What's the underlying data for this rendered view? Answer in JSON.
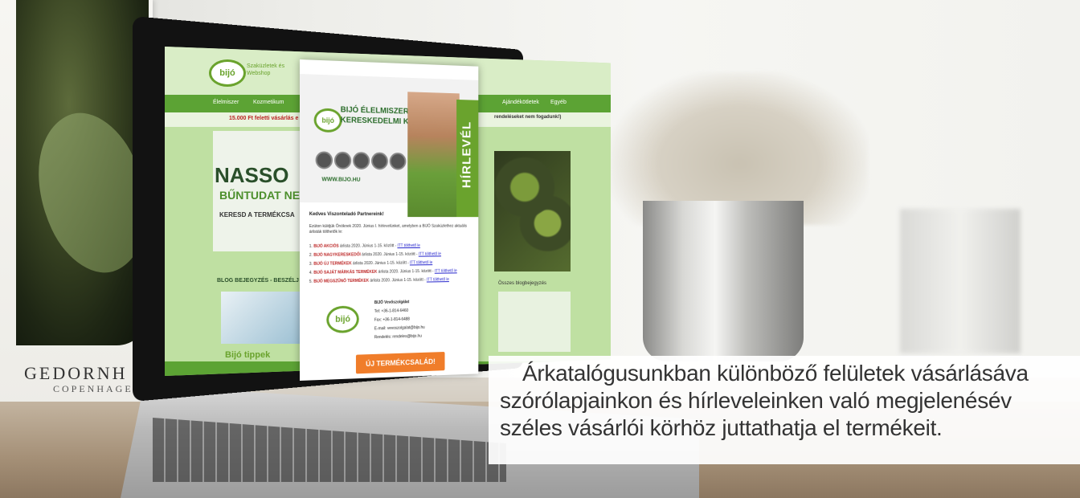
{
  "poster": {
    "brand": "GEDORNH",
    "city": "COPENHAGEN"
  },
  "site": {
    "logo": "bijó",
    "tagline": "Szaküzletek és Webshop",
    "nav_items": [
      "Élelmiszer",
      "Kozmetikum",
      "Ajándékötletek",
      "Egyéb"
    ],
    "promo": "15.000 Ft feletti vásárlás e",
    "hero_title": "NASSO",
    "hero_sub": "BŰNTUDAT NE",
    "hero_sub2": "KERESD A TERMÉKCSA",
    "blog_head": "BLOG BEJEGYZÉS - BESZÉLJ",
    "blog_title": "Bijó tippek",
    "right_notice": "rendeléseket nem fogadunk!)",
    "right_more": "Összes blogbejegyzés"
  },
  "newsletter": {
    "company_line1": "BIJÓ ÉLELMISZER",
    "company_line2": "KERESKEDELMI KFT.",
    "website": "WWW.BIJO.HU",
    "vertical_label": "HÍRLEVÉL",
    "greeting": "Kedves Viszonteladó Partnereink!",
    "intro": "Ezúton küldjük Önöknek 2020. Június I. hírlevelünket, amelyben a BIJÓ Szaküzlethez aktuális árlisták tölthetők le:",
    "items": [
      {
        "num": "1.",
        "name": "BIJÓ AKCIÓS",
        "text": " árlista 2020. Június 1-15. között - ",
        "link": "ITT tölthető le"
      },
      {
        "num": "2.",
        "name": "BIJÓ NAGYKERESKEDŐI",
        "text": " árlista 2020. Június 1-15. között - ",
        "link": "ITT tölthető le"
      },
      {
        "num": "3.",
        "name": "BIJÓ ÚJ TERMÉKEK",
        "text": " árlista 2020. Június 1-15. között - ",
        "link": "ITT tölthető le"
      },
      {
        "num": "4.",
        "name": "BIJÓ SAJÁT MÁRKÁS TERMÉKEK",
        "text": " árlista 2020. Június 1-15. között - ",
        "link": "ITT tölthető le"
      },
      {
        "num": "5.",
        "name": "BIJÓ MEGSZŰNŐ TERMÉKEK",
        "text": " árlista 2020. Június 1-15. között - ",
        "link": "ITT tölthető le"
      }
    ],
    "logo": "bijó",
    "contact_title": "BIJÓ Vevőszolgálat",
    "tel": "Tel: +36-1-814-6460",
    "fax": "Fax: +36-1-814-6488",
    "email": "E-mail: vevoszolgalat@bijo.hu",
    "order": "Rendelés: rendeles@bijo.hu",
    "cta": "ÚJ TERMÉKCSALÁD!"
  },
  "caption": {
    "line1": "Árkatalógusunkban különböző felületek vásárlásáva",
    "line2": "szórólapjainkon és hírleveleinken való megjelenésév",
    "line3": "széles vásárlói körhöz juttathatja el termékeit."
  }
}
